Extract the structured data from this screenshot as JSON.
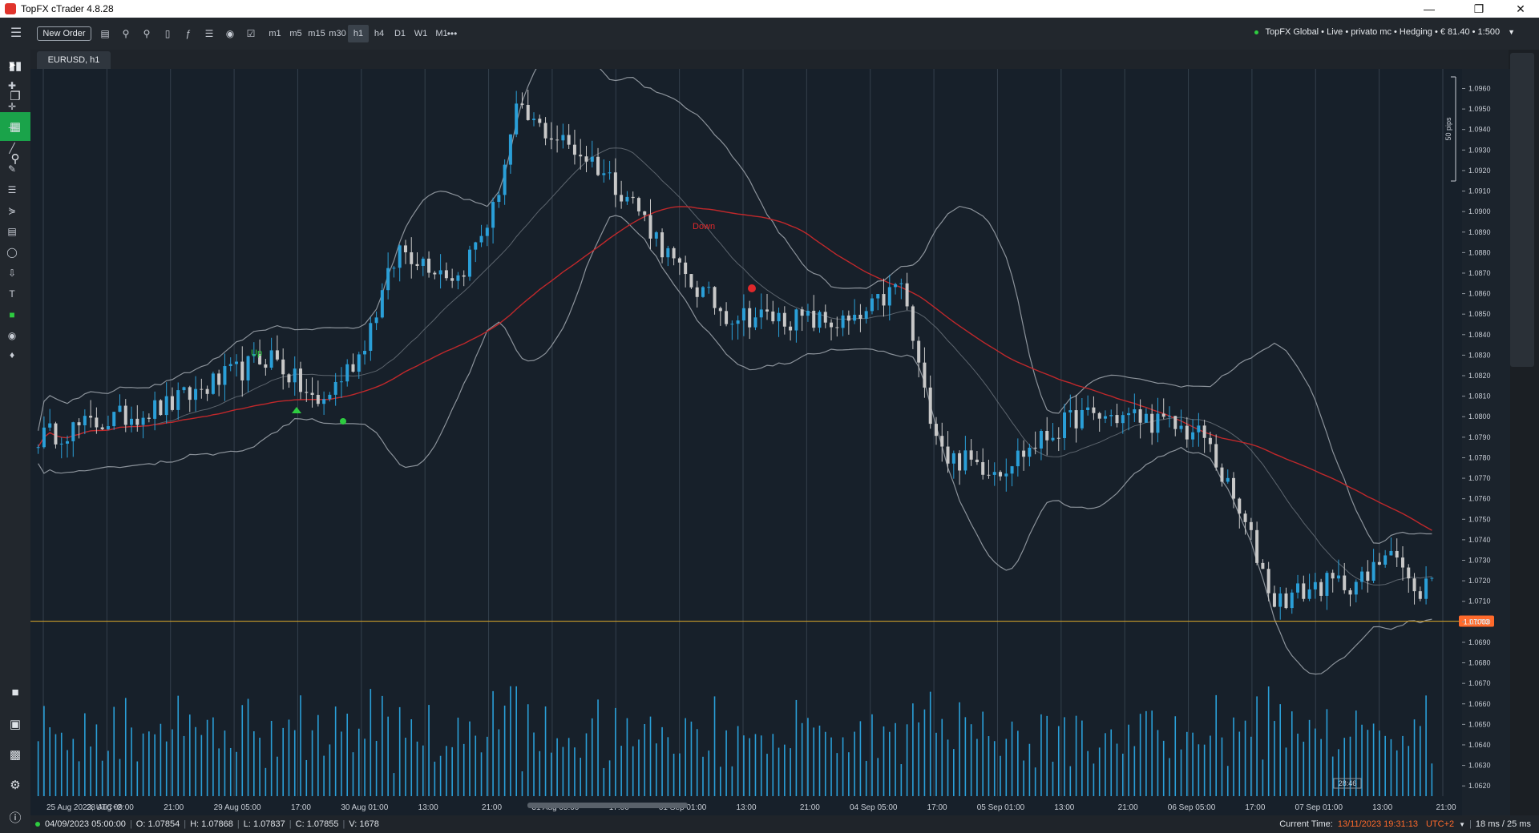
{
  "window": {
    "title": "TopFX cTrader 4.8.28"
  },
  "toolbar": {
    "new_order_label": "New Order",
    "timeframes": [
      "m1",
      "m5",
      "m15",
      "m30",
      "h1",
      "h4",
      "D1",
      "W1",
      "M1"
    ],
    "active_timeframe": "h1",
    "more_label": "•••",
    "account_label": "TopFX Global • Live • privato mc • Hedging • € 81.40 • 1:500"
  },
  "chart": {
    "tab_label": "EURUSD, h1",
    "current_price": "1.07003",
    "price_levels": [
      "1.0960",
      "1.0950",
      "1.0940",
      "1.0930",
      "1.0920",
      "1.0910",
      "1.0900",
      "1.0890",
      "1.0880",
      "1.0870",
      "1.0860",
      "1.0850",
      "1.0840",
      "1.0830",
      "1.0820",
      "1.0810",
      "1.0800",
      "1.0790",
      "1.0780",
      "1.0770",
      "1.0760",
      "1.0750",
      "1.0740",
      "1.0730",
      "1.0720",
      "1.0710",
      "1.0700",
      "1.0690",
      "1.0680",
      "1.0670",
      "1.0660",
      "1.0650",
      "1.0640",
      "1.0630",
      "1.0620"
    ],
    "time_labels": [
      "25 Aug 2023, UTC+2",
      "28 Aug 09:00",
      "21:00",
      "29 Aug 05:00",
      "17:00",
      "30 Aug 01:00",
      "13:00",
      "21:00",
      "31 Aug 05:00",
      "17:00",
      "01 Sep 01:00",
      "13:00",
      "21:00",
      "04 Sep 05:00",
      "17:00",
      "05 Sep 01:00",
      "13:00",
      "21:00",
      "06 Sep 05:00",
      "17:00",
      "07 Sep 01:00",
      "13:00",
      "21:00"
    ],
    "pips_label": "50 pips",
    "annotation_up": "Up",
    "annotation_down": "Down",
    "countdown_label": "28:46",
    "colors": {
      "bullish": "#2a9fd8",
      "bearish": "#c8c8c8",
      "ma": "#c0282b",
      "bands": "#8c939b",
      "price_line": "#c89a2a",
      "volume": "#2a9fd8",
      "background": "#17202a"
    }
  },
  "statusbar": {
    "bar_time": "04/09/2023 05:00:00",
    "open": "O: 1.07854",
    "high": "H: 1.07868",
    "low": "L: 1.07837",
    "close": "C: 1.07855",
    "volume": "V: 1678",
    "current_time_label": "Current Time:",
    "current_time": "13/11/2023 19:31:13",
    "timezone": "UTC+2",
    "latency": "18 ms / 25 ms"
  }
}
